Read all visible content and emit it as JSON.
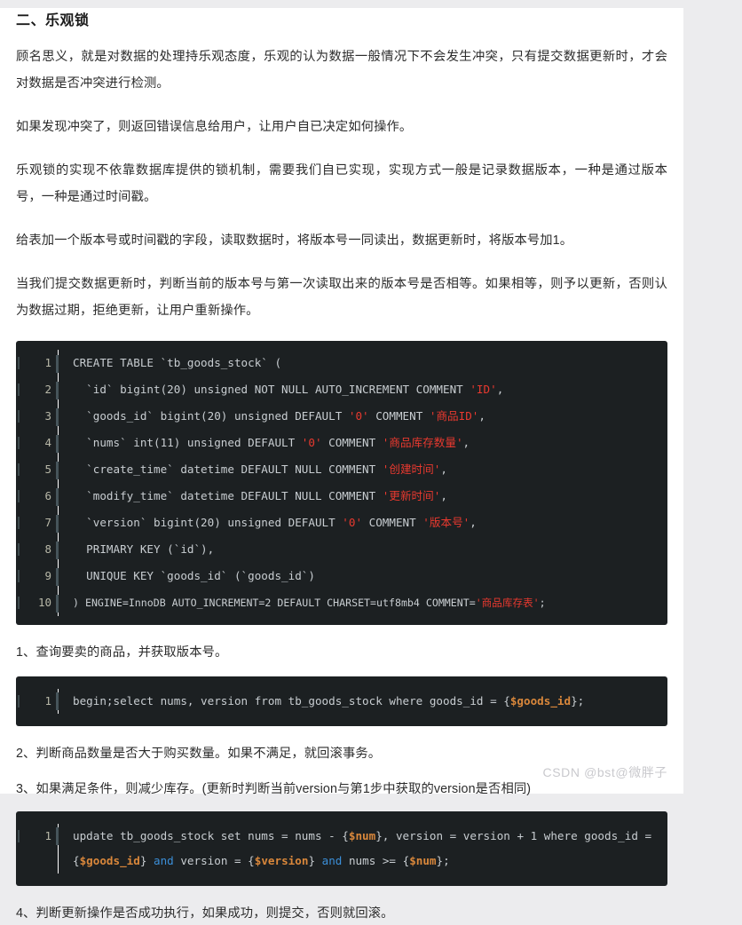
{
  "article": {
    "heading": "二、乐观锁",
    "paragraphs": [
      "顾名思义，就是对数据的处理持乐观态度，乐观的认为数据一般情况下不会发生冲突，只有提交数据更新时，才会对数据是否冲突进行检测。",
      "如果发现冲突了，则返回错误信息给用户，让用户自已决定如何操作。",
      "乐观锁的实现不依靠数据库提供的锁机制，需要我们自已实现，实现方式一般是记录数据版本，一种是通过版本号，一种是通过时间戳。",
      "给表加一个版本号或时间戳的字段，读取数据时，将版本号一同读出，数据更新时，将版本号加1。",
      "当我们提交数据更新时，判断当前的版本号与第一次读取出来的版本号是否相等。如果相等，则予以更新，否则认为数据过期，拒绝更新，让用户重新操作。"
    ],
    "steps": [
      "1、查询要卖的商品，并获取版本号。",
      "2、判断商品数量是否大于购买数量。如果不满足，就回滚事务。",
      "3、如果满足条件，则减少库存。(更新时判断当前version与第1步中获取的version是否相同)",
      "4、判断更新操作是否成功执行，如果成功，则提交，否则就回滚。"
    ]
  },
  "code_blocks": {
    "create_table": {
      "language": "sql",
      "line_numbers": [
        "1",
        "2",
        "3",
        "4",
        "5",
        "6",
        "7",
        "8",
        "9",
        "10"
      ],
      "lines": [
        "CREATE TABLE `tb_goods_stock` (",
        "  `id` bigint(20) unsigned NOT NULL AUTO_INCREMENT COMMENT 'ID',",
        "  `goods_id` bigint(20) unsigned DEFAULT '0' COMMENT '商品ID',",
        "  `nums` int(11) unsigned DEFAULT '0' COMMENT '商品库存数量',",
        "  `create_time` datetime DEFAULT NULL COMMENT '创建时间',",
        "  `modify_time` datetime DEFAULT NULL COMMENT '更新时间',",
        "  `version` bigint(20) unsigned DEFAULT '0' COMMENT '版本号',",
        "  PRIMARY KEY (`id`),",
        "  UNIQUE KEY `goods_id` (`goods_id`)",
        ") ENGINE=InnoDB AUTO_INCREMENT=2 DEFAULT CHARSET=utf8mb4 COMMENT='商品库存表';"
      ]
    },
    "select_query": {
      "language": "sql",
      "line_numbers": [
        "1"
      ],
      "lines": [
        "begin;select nums, version from tb_goods_stock where goods_id = {$goods_id};"
      ]
    },
    "update_query": {
      "language": "sql",
      "line_numbers": [
        "1"
      ],
      "lines": [
        "update tb_goods_stock set nums = nums - {$num}, version = version + 1 where goods_id = {$goods_id} and version = {$version} and nums >= {$num};"
      ]
    }
  },
  "watermark": "CSDN @bst@微胖子",
  "colors": {
    "code_background": "#1c2022",
    "code_text": "#c8cdd1",
    "string_literal": "#e8392f",
    "variable": "#d9873b",
    "keyword": "#3b8fd9",
    "line_number": "#b8b8a8",
    "page_background": "#ffffff",
    "outer_background": "#ececee",
    "body_text": "#2c2c2c"
  }
}
